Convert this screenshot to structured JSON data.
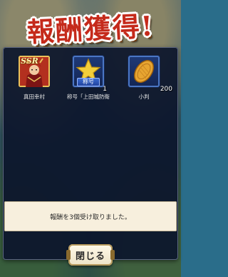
{
  "title": "報酬獲得!",
  "rewards": [
    {
      "badge": "SSR",
      "quantity": "",
      "label": "真田幸村",
      "icon": "warrior-portrait"
    },
    {
      "badge": "称号",
      "quantity": "1",
      "label": "称号「上田城防衛",
      "icon": "star-icon"
    },
    {
      "badge": "",
      "quantity": "200",
      "label": "小判",
      "icon": "gold-coin-icon"
    }
  ],
  "message": "報酬を3個受け取りました。",
  "close_button": {
    "label": "閉じる"
  },
  "colors": {
    "title": "#c52a1b",
    "panel": "#0c162c",
    "message_bg": "#f7efdd",
    "accent": "#4a76c4"
  }
}
